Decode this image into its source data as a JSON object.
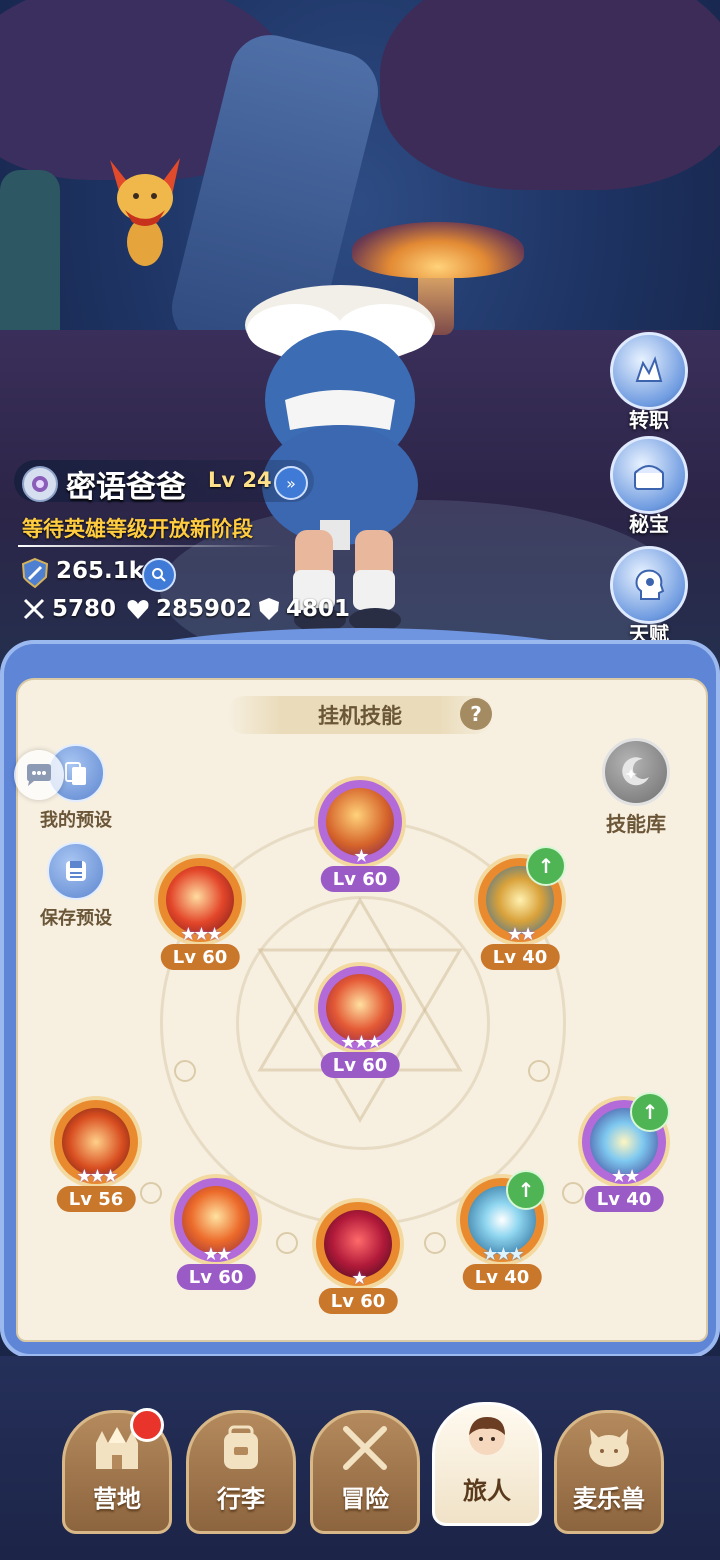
{
  "character": {
    "name": "密语爸爸",
    "level": "Lv 24",
    "stage_text": "等待英雄等级开放新阶段",
    "power": "265.1k",
    "attack": "5780",
    "hp": "285902",
    "defense": "4801"
  },
  "side_menu": [
    {
      "label": "转职",
      "icon": "class-change-icon"
    },
    {
      "label": "秘宝",
      "icon": "treasure-icon"
    },
    {
      "label": "天赋",
      "icon": "talent-icon"
    }
  ],
  "panel": {
    "title": "挂机技能",
    "help": "?",
    "my_preset": "我的预设",
    "save_preset": "保存预设",
    "skill_library": "技能库"
  },
  "skills": [
    {
      "id": "top",
      "level": "Lv 60",
      "stars": "★",
      "frame": "purple",
      "upgrade": false
    },
    {
      "id": "upper-left",
      "level": "Lv 60",
      "stars": "★★★",
      "frame": "orange",
      "upgrade": false
    },
    {
      "id": "upper-right",
      "level": "Lv 40",
      "stars": "★★",
      "frame": "orange",
      "upgrade": true
    },
    {
      "id": "center",
      "level": "Lv 60",
      "stars": "★★★",
      "frame": "purple",
      "upgrade": false
    },
    {
      "id": "lower-left-outer",
      "level": "Lv 56",
      "stars": "★★★",
      "frame": "orange",
      "upgrade": false
    },
    {
      "id": "lower-left-inner",
      "level": "Lv 60",
      "stars": "★★",
      "frame": "purple",
      "upgrade": false
    },
    {
      "id": "bottom",
      "level": "Lv 60",
      "stars": "★",
      "frame": "orange",
      "upgrade": false
    },
    {
      "id": "lower-right-inner",
      "level": "Lv 40",
      "stars": "★★★",
      "frame": "orange",
      "upgrade": true
    },
    {
      "id": "lower-right-outer",
      "level": "Lv 40",
      "stars": "★★",
      "frame": "purple",
      "upgrade": true
    }
  ],
  "nav": [
    {
      "label": "营地",
      "icon": "castle-icon",
      "active": false,
      "badge": true
    },
    {
      "label": "行李",
      "icon": "backpack-icon",
      "active": false,
      "badge": false
    },
    {
      "label": "冒险",
      "icon": "crossed-swords-icon",
      "active": false,
      "badge": false
    },
    {
      "label": "旅人",
      "icon": "traveler-icon",
      "active": true,
      "badge": false
    },
    {
      "label": "麦乐兽",
      "icon": "pet-icon",
      "active": false,
      "badge": false
    }
  ],
  "colors": {
    "orange_frame": "#e98a2e",
    "purple_frame": "#b36bd9",
    "lv_orange": "#c9772a",
    "lv_purple": "#9b5bc7",
    "upgrade_green": "#4fb554"
  }
}
